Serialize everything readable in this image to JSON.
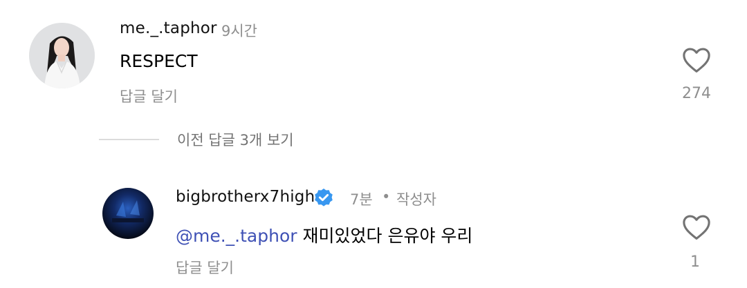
{
  "comments": [
    {
      "username": "me._.taphor",
      "time": "9시간",
      "text": "RESPECT",
      "reply_label": "답글 달기",
      "like_count": "274"
    }
  ],
  "view_replies": {
    "label": "이전 답글 3개 보기"
  },
  "replies": [
    {
      "username": "bigbrotherx7high",
      "time": "7분",
      "separator": "•",
      "author_badge": "작성자",
      "mention": "@me._.taphor",
      "text": " 재미있었다 은유야 우리",
      "reply_label": "답글 달기",
      "like_count": "1"
    }
  ],
  "colors": {
    "mention": "#3f51b5",
    "verified": "#3897f0",
    "muted": "#8e8e8e"
  },
  "icons": [
    "heart-outline-icon",
    "verified-badge-icon"
  ]
}
